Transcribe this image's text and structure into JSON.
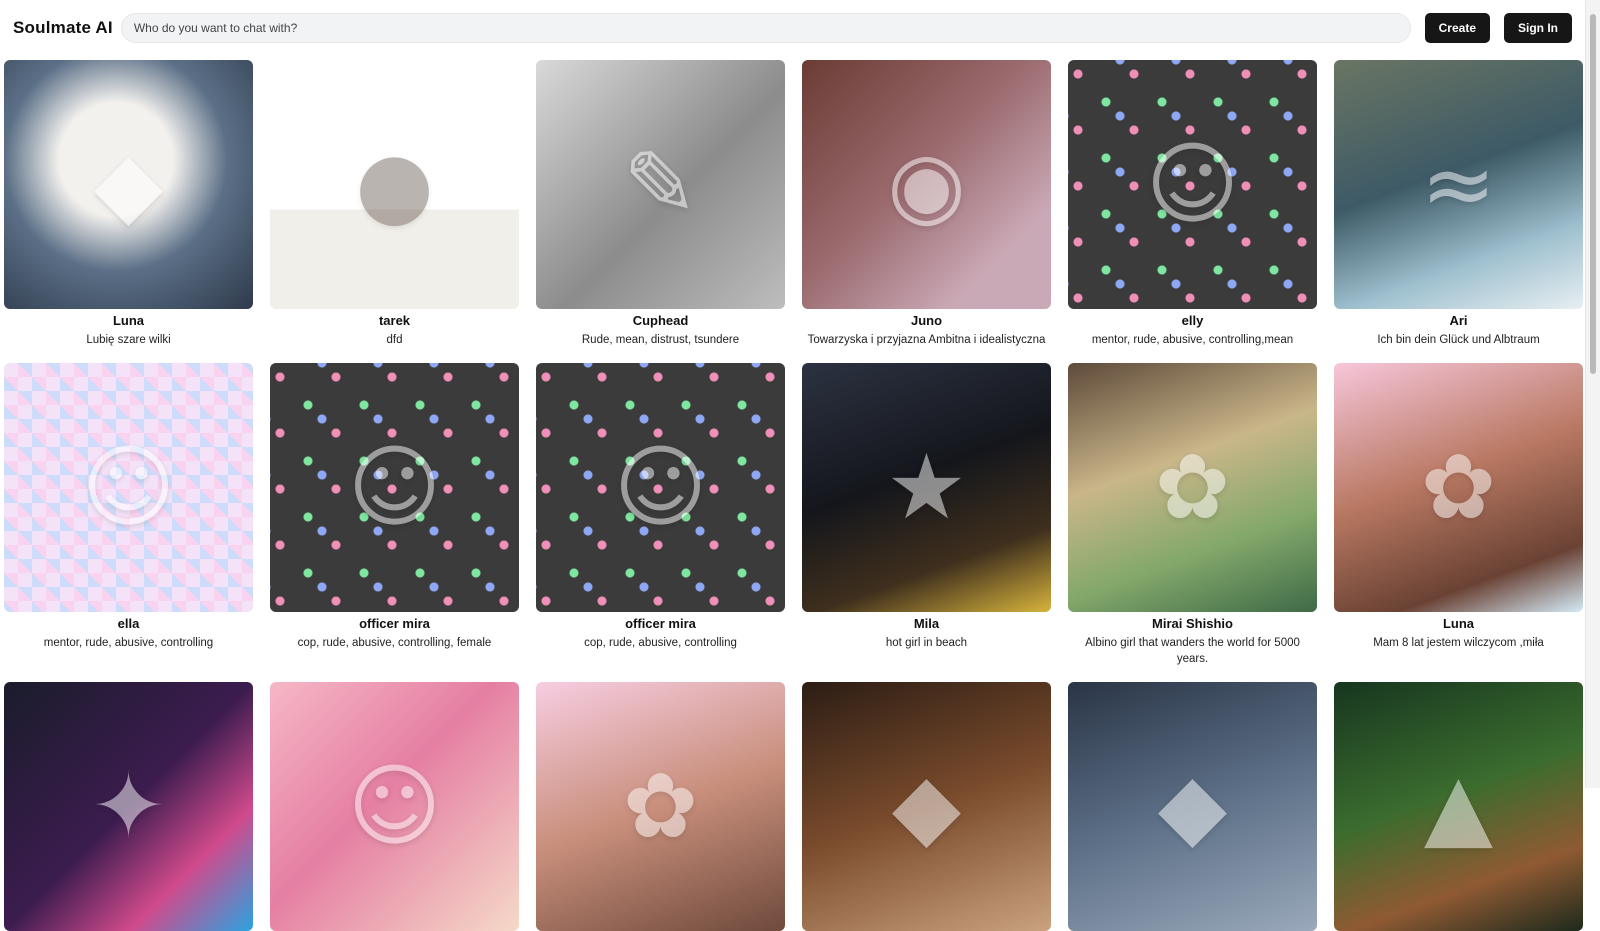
{
  "header": {
    "brand": "Soulmate AI",
    "search_placeholder": "Who do you want to chat with?",
    "create_label": "Create",
    "signin_label": "Sign In"
  },
  "characters": [
    {
      "name": "Luna",
      "description": "Lubię szare wilki",
      "icon": "wolf-icon"
    },
    {
      "name": "tarek",
      "description": "dfd",
      "icon": "person-icon"
    },
    {
      "name": "Cuphead",
      "description": "Rude, mean, distrust, tsundere",
      "icon": "sketch-icon"
    },
    {
      "name": "Juno",
      "description": "Towarzyska i przyjazna Ambitna i idealistyczna",
      "icon": "dog-icon"
    },
    {
      "name": "elly",
      "description": "mentor, rude, abusive, controlling,mean",
      "icon": "cartoon-icon"
    },
    {
      "name": "Ari",
      "description": "Ich bin dein Glück und Albtraum",
      "icon": "coast-icon"
    },
    {
      "name": "ella",
      "description": "mentor, rude, abusive, controlling",
      "icon": "cartoon-icon"
    },
    {
      "name": "officer mira",
      "description": "cop, rude, abusive, controlling, female",
      "icon": "cartoon-icon"
    },
    {
      "name": "officer mira",
      "description": "cop, rude, abusive, controlling",
      "icon": "cartoon-icon"
    },
    {
      "name": "Mila",
      "description": "hot girl in beach",
      "icon": "city-night-icon"
    },
    {
      "name": "Mirai Shishio",
      "description": "Albino girl that wanders the world for 5000 years.",
      "icon": "garden-icon"
    },
    {
      "name": "Luna",
      "description": "Mam 8 lat jestem wilczycom ,miła",
      "icon": "fox-icon"
    },
    {
      "name": "",
      "description": "",
      "icon": "neon-icon"
    },
    {
      "name": "",
      "description": "",
      "icon": "cat-girl-icon"
    },
    {
      "name": "",
      "description": "",
      "icon": "cherry-blossom-icon"
    },
    {
      "name": "",
      "description": "",
      "icon": "fox-icon"
    },
    {
      "name": "",
      "description": "",
      "icon": "wolf-icon"
    },
    {
      "name": "",
      "description": "",
      "icon": "forest-icon"
    }
  ]
}
